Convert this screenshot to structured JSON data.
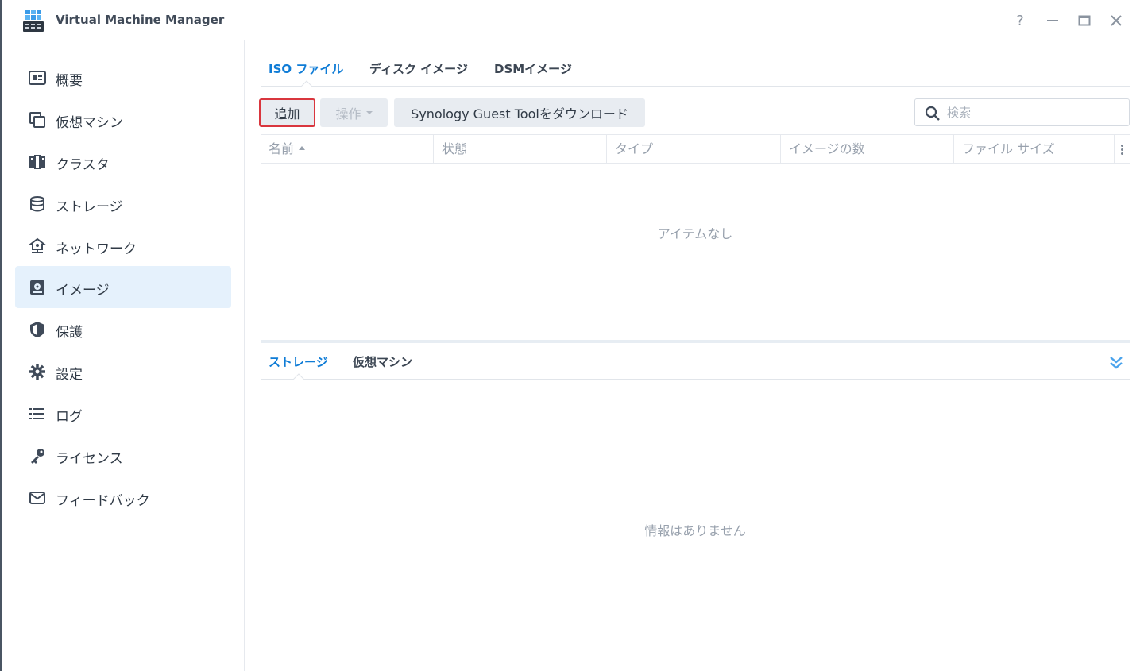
{
  "window": {
    "title": "Virtual Machine Manager",
    "controls": {
      "help": "?"
    }
  },
  "sidebar": {
    "items": [
      {
        "label": "概要",
        "icon": "overview-icon"
      },
      {
        "label": "仮想マシン",
        "icon": "vm-icon"
      },
      {
        "label": "クラスタ",
        "icon": "cluster-icon"
      },
      {
        "label": "ストレージ",
        "icon": "storage-icon"
      },
      {
        "label": "ネットワーク",
        "icon": "network-icon"
      },
      {
        "label": "イメージ",
        "icon": "image-icon",
        "active": true
      },
      {
        "label": "保護",
        "icon": "shield-icon"
      },
      {
        "label": "設定",
        "icon": "gear-icon"
      },
      {
        "label": "ログ",
        "icon": "list-icon"
      },
      {
        "label": "ライセンス",
        "icon": "key-icon"
      },
      {
        "label": "フィードバック",
        "icon": "mail-icon"
      }
    ]
  },
  "main": {
    "tabs": [
      {
        "label": "ISO ファイル",
        "active": true
      },
      {
        "label": "ディスク イメージ"
      },
      {
        "label": "DSMイメージ"
      }
    ],
    "toolbar": {
      "add_label": "追加",
      "action_label": "操作",
      "download_label": "Synology Guest Toolをダウンロード",
      "search_placeholder": "検索"
    },
    "table": {
      "columns": [
        "名前",
        "状態",
        "タイプ",
        "イメージの数",
        "ファイル サイズ"
      ],
      "sorted_column": "名前",
      "empty_text": "アイテムなし"
    },
    "detail": {
      "tabs": [
        {
          "label": "ストレージ",
          "active": true
        },
        {
          "label": "仮想マシン"
        }
      ],
      "empty_text": "情報はありません"
    }
  },
  "colors": {
    "accent": "#0f7cd6",
    "active_bg": "#e5f1fc",
    "highlight_border": "#d9363e"
  }
}
